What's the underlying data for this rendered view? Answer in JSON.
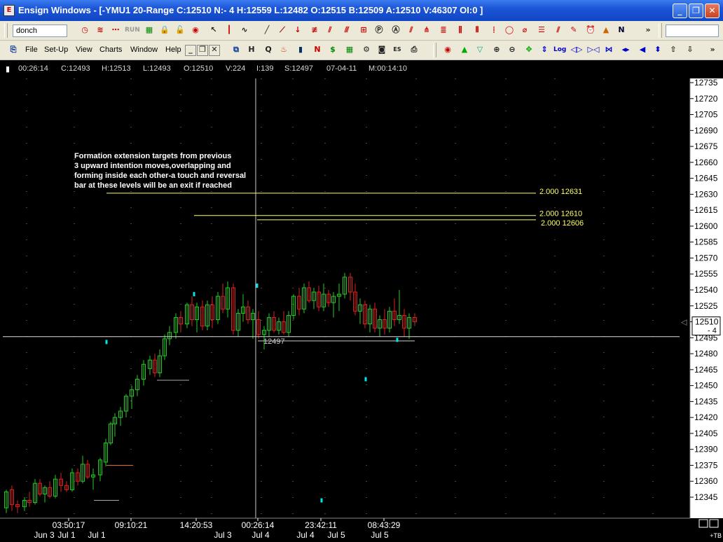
{
  "window": {
    "title": "Ensign Windows - [-YMU1 20-Range C:12510 N:- 4 H:12559 L:12482 O:12515 B:12509 A:12510 V:46307 OI:0 ]",
    "minimize": "_",
    "maximize": "❐",
    "close": "✕"
  },
  "toolbar": {
    "symbol_combo": "donch",
    "run_label": "RUN"
  },
  "menu": [
    "File",
    "Set-Up",
    "View",
    "Charts",
    "Window",
    "Help"
  ],
  "status": {
    "time": "00:26:14",
    "close": "C:12493",
    "high": "H:12513",
    "low": "L:12493",
    "open": "O:12510",
    "volume": "V:224",
    "interval": "I:139",
    "s": "S:12497",
    "date": "07-04-11",
    "m": "M:00:14:10"
  },
  "chart_data": {
    "type": "candlestick",
    "ylim": [
      12330,
      12740
    ],
    "price_ticks": [
      12735,
      12720,
      12705,
      12690,
      12675,
      12660,
      12645,
      12630,
      12615,
      12600,
      12585,
      12570,
      12555,
      12540,
      12525,
      12510,
      12495,
      12480,
      12465,
      12450,
      12435,
      12420,
      12405,
      12390,
      12375,
      12360,
      12345
    ],
    "current_price_label": "12510",
    "change_label": "- 4",
    "time_labels": [
      "03:50:17",
      "09:10:21",
      "14:20:53",
      "00:26:14",
      "23:42:11",
      "08:43:29"
    ],
    "date_labels": [
      "Jun 3",
      "Jul 1",
      "Jul 1",
      "Jul 3",
      "Jul 4",
      "Jul 4",
      "Jul 5",
      "Jul 5"
    ],
    "corner_label": "+TB",
    "annotation": "Formation extension targets from previous\n3 upward intention moves,overlapping and\nforming inside each other-a touch and reversal\nbar at these levels will be an exit if reached",
    "target_lines": [
      {
        "label": "2.000  12631",
        "price": 12631
      },
      {
        "label": "2.000  12610",
        "price": 12610
      },
      {
        "label": "2.000  12606",
        "price": 12606
      }
    ],
    "crosshair_label": "12497",
    "colors": {
      "up": "#22cc22",
      "down": "#dd2222",
      "target": "#ffff66",
      "marker": "#00e5e5",
      "crosshair": "#ffffff"
    }
  }
}
